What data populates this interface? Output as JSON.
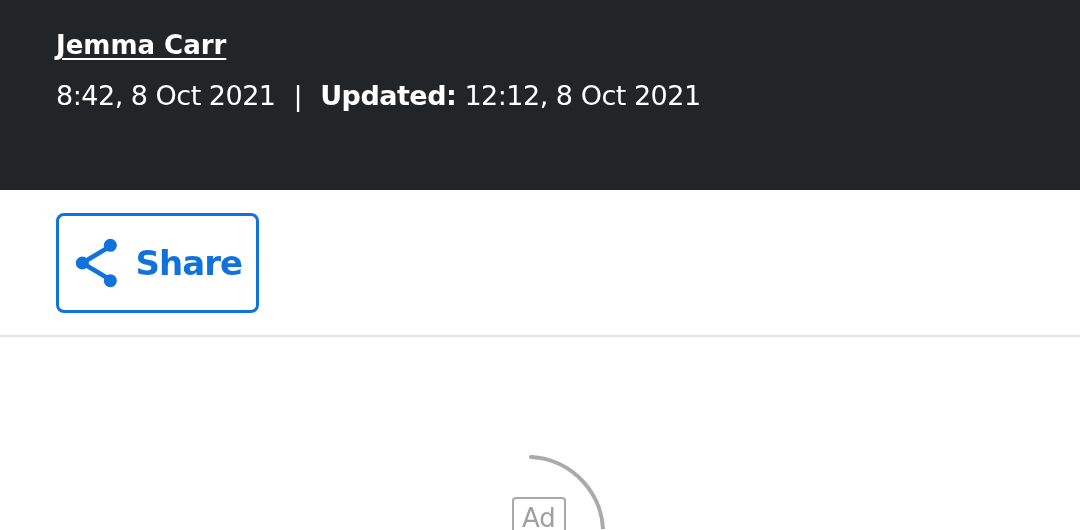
{
  "header": {
    "author": "Jemma Carr",
    "published": "8:42, 8 Oct 2021",
    "separator": "|",
    "updated": "**Updated:** 12:12, 8 Oct 2021"
  },
  "share_button": {
    "label": "Share"
  },
  "ad": {
    "label": "Ad"
  }
}
